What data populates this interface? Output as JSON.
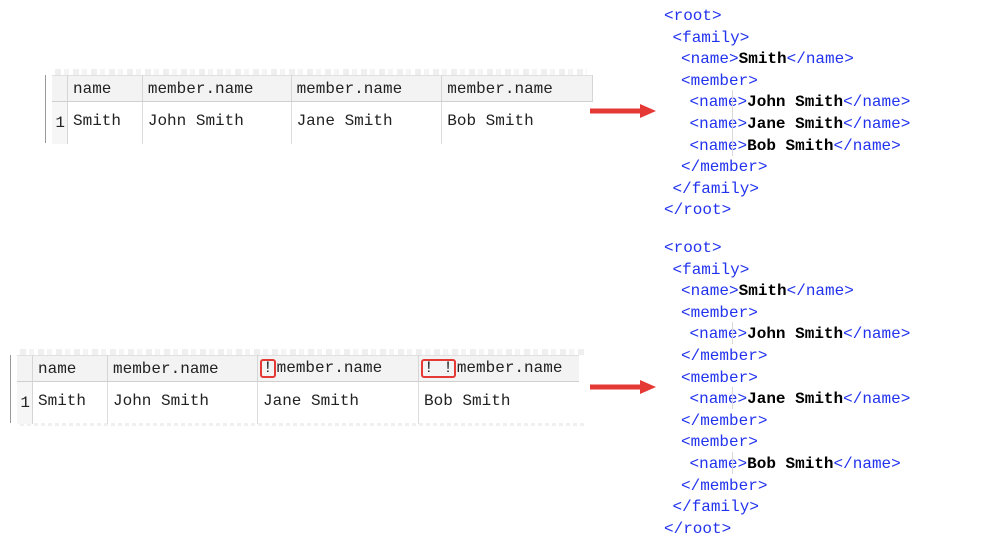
{
  "colors": {
    "arrow": "#e53935",
    "xml_tag": "#2233ee",
    "xml_value": "#000000",
    "highlight_box": "#e53935"
  },
  "examples": [
    {
      "grid": {
        "columns": [
          {
            "prefix": "",
            "label": "name"
          },
          {
            "prefix": "",
            "label": "member.name"
          },
          {
            "prefix": "",
            "label": "member.name"
          },
          {
            "prefix": "",
            "label": "member.name"
          }
        ],
        "rows": [
          {
            "row_number": "1",
            "cells": [
              "Smith",
              "John Smith",
              "Jane Smith",
              "Bob Smith"
            ]
          }
        ]
      },
      "arrow_icon": "arrow-right",
      "xml": {
        "root_open": "<root>",
        "family_open": "<family>",
        "family_name": {
          "open": "<name>",
          "value": "Smith",
          "close": "</name>"
        },
        "members": [
          {
            "open": "<member>",
            "names": [
              {
                "open": "<name>",
                "value": "John Smith",
                "close": "</name>"
              },
              {
                "open": "<name>",
                "value": "Jane Smith",
                "close": "</name>"
              },
              {
                "open": "<name>",
                "value": "Bob Smith",
                "close": "</name>"
              }
            ],
            "close": "</member>"
          }
        ],
        "family_close": "</family>",
        "root_close": "</root>"
      }
    },
    {
      "grid": {
        "columns": [
          {
            "prefix": "",
            "label": "name"
          },
          {
            "prefix": "",
            "label": "member.name"
          },
          {
            "prefix": "!",
            "label": "member.name"
          },
          {
            "prefix": "!!",
            "label": "member.name"
          }
        ],
        "rows": [
          {
            "row_number": "1",
            "cells": [
              "Smith",
              "John Smith",
              "Jane Smith",
              "Bob Smith"
            ]
          }
        ]
      },
      "arrow_icon": "arrow-right",
      "xml": {
        "root_open": "<root>",
        "family_open": "<family>",
        "family_name": {
          "open": "<name>",
          "value": "Smith",
          "close": "</name>"
        },
        "members": [
          {
            "open": "<member>",
            "names": [
              {
                "open": "<name>",
                "value": "John Smith",
                "close": "</name>"
              }
            ],
            "close": "</member>"
          },
          {
            "open": "<member>",
            "names": [
              {
                "open": "<name>",
                "value": "Jane Smith",
                "close": "</name>"
              }
            ],
            "close": "</member>"
          },
          {
            "open": "<member>",
            "names": [
              {
                "open": "<name>",
                "value": "Bob Smith",
                "close": "</name>"
              }
            ],
            "close": "</member>"
          }
        ],
        "family_close": "</family>",
        "root_close": "</root>"
      }
    }
  ]
}
